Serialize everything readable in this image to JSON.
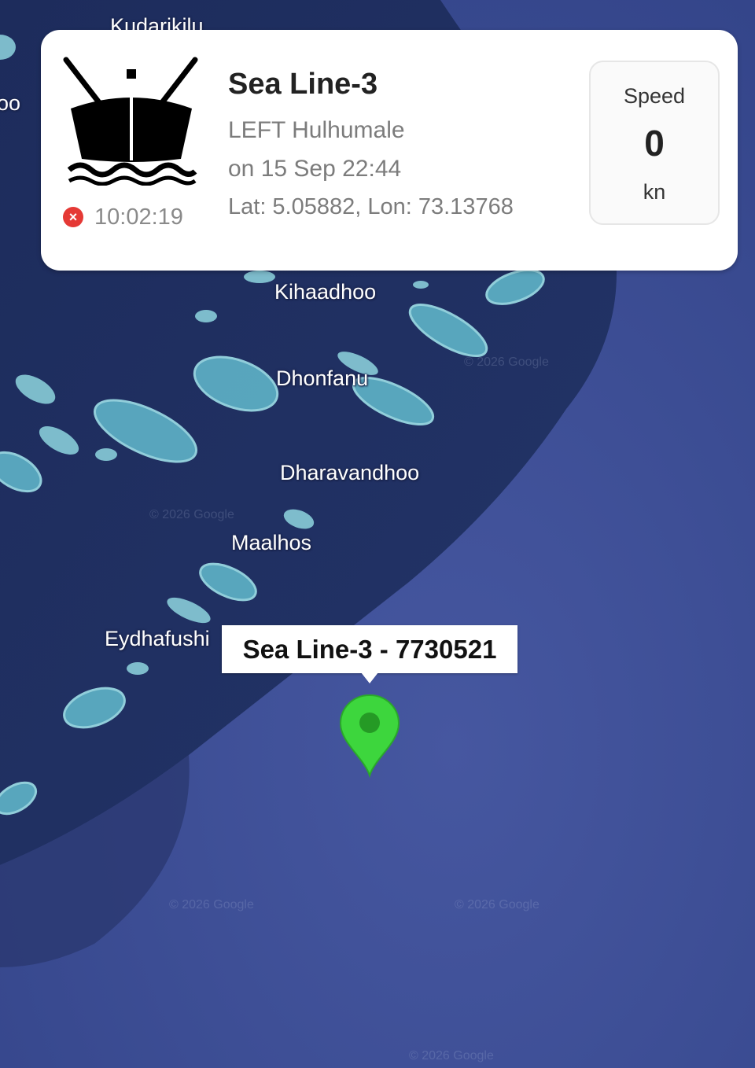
{
  "map": {
    "places": [
      {
        "id": "kudarikilu",
        "label": "Kudarikilu"
      },
      {
        "id": "edge-oo",
        "label": "oo"
      },
      {
        "id": "kihaadhoo",
        "label": "Kihaadhoo"
      },
      {
        "id": "dhonfanu",
        "label": "Dhonfanu"
      },
      {
        "id": "dharavandhoo",
        "label": "Dharavandhoo"
      },
      {
        "id": "maalhos",
        "label": "Maalhos"
      },
      {
        "id": "eydhafushi",
        "label": "Eydhafushi"
      }
    ],
    "watermark": "© 2026 Google"
  },
  "vessel_card": {
    "icon": "ship-icon",
    "name": "Sea Line-3",
    "status_line": "LEFT Hulhumale",
    "date_line": "on 15 Sep 22:44",
    "coords_line": "Lat: 5.05882, Lon: 73.13768",
    "status_icon": "x-circle-icon",
    "status_icon_color": "#e53935",
    "status_time": "10:02:19",
    "speed": {
      "label": "Speed",
      "value": "0",
      "unit": "kn"
    }
  },
  "marker": {
    "label": "Sea Line-3 - 7730521",
    "icon": "map-pin-icon",
    "color": "#3dd63d"
  }
}
